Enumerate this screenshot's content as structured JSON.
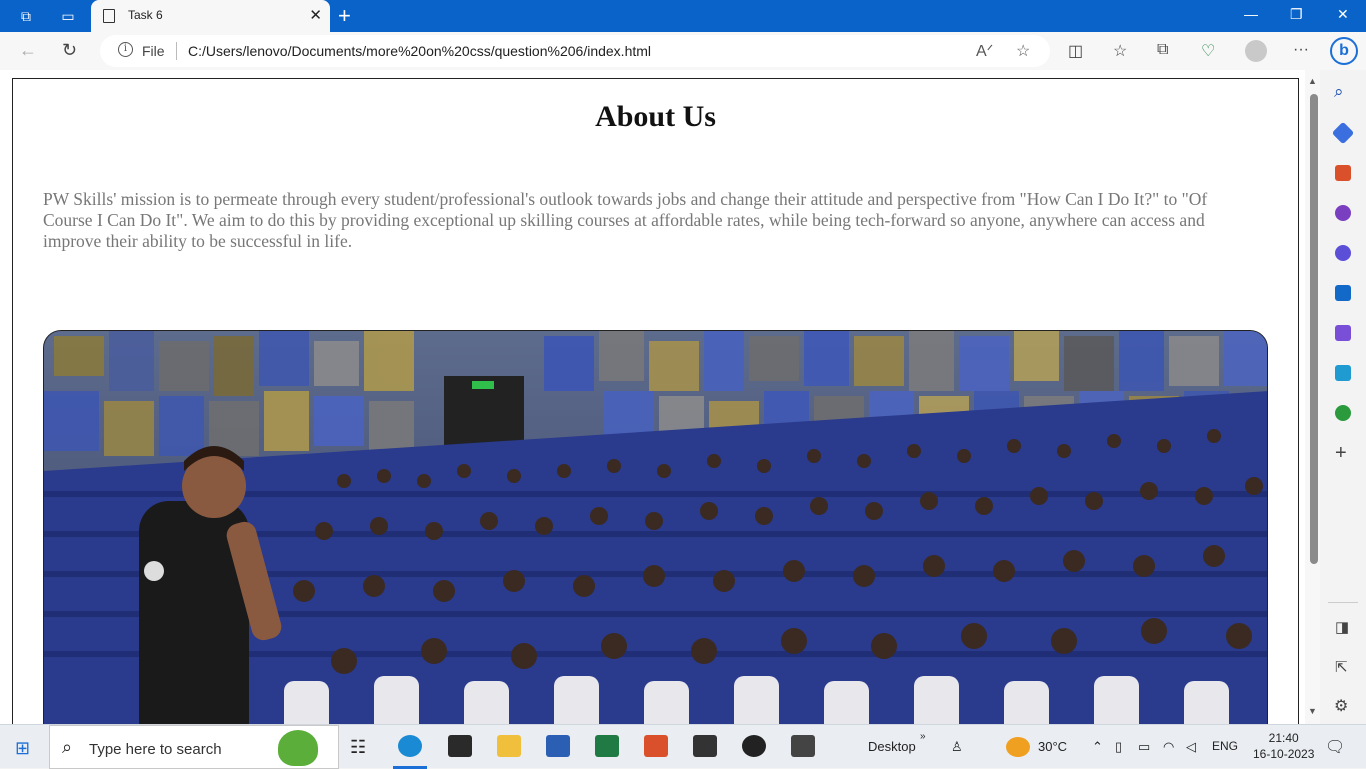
{
  "browser": {
    "tab_title": "Task 6",
    "file_label": "File",
    "url": "C:/Users/lenovo/Documents/more%20on%20css/question%206/index.html"
  },
  "page": {
    "heading": "About Us",
    "paragraph": "PW Skills' mission is to permeate through every student/professional's outlook towards jobs and change their attitude and perspective from \"How Can I Do It?\" to \"Of Course I Can Do It\". We aim to do this by providing exceptional up skilling courses at affordable rates, while being tech-forward so anyone, anywhere can access and improve their ability to be successful in life."
  },
  "taskbar": {
    "search_placeholder": "Type here to search",
    "desktop_label": "Desktop",
    "temperature": "30°C",
    "language": "ENG",
    "time": "21:40",
    "date": "16-10-2023"
  },
  "colors": {
    "titlebar": "#0a63c9",
    "paragraph_text": "#777777",
    "seat_blue": "#2c3f94"
  }
}
